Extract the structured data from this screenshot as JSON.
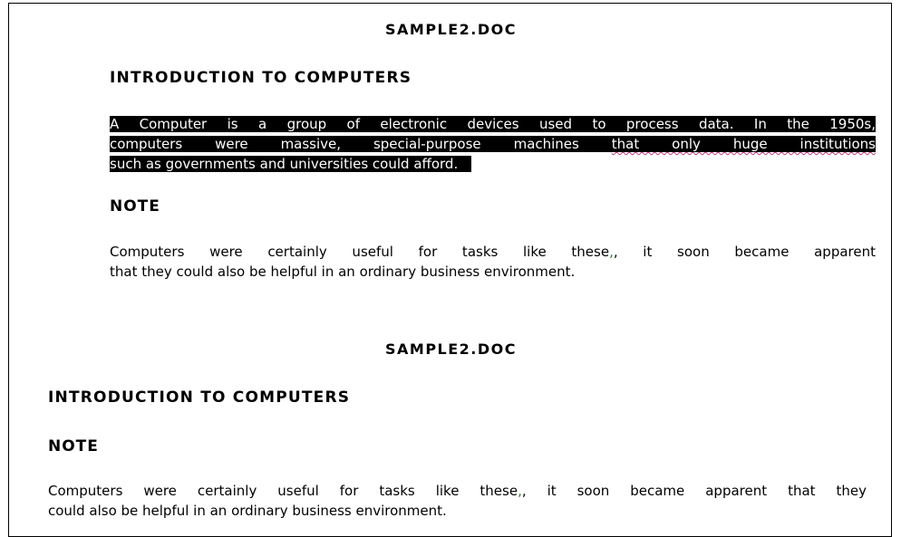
{
  "section1": {
    "doc_title": "SAMPLE2.DOC",
    "heading": "INTRODUCTION TO COMPUTERS",
    "selected_paragraph": {
      "line1": "A Computer is a group of electronic devices used to process data. In the 1950s,",
      "line2_a": "computers were massive, special-purpose machines",
      "line2_b": "that only huge institutions",
      "line3": "such as governments and universities could afford."
    },
    "note_heading": "NOTE",
    "note_paragraph": {
      "line1_a": "Computers were certainly useful for tasks like these",
      "line1_b": ", it soon became apparent",
      "line2": "that they could also be helpful in an ordinary business environment."
    }
  },
  "section2": {
    "doc_title": "SAMPLE2.DOC",
    "heading": "INTRODUCTION TO COMPUTERS",
    "note_heading": "NOTE",
    "note_paragraph": {
      "line1_a": "Computers were certainly useful for tasks like these",
      "line1_b": ", it soon became apparent that they",
      "line2": "could also be helpful in an ordinary business environment."
    }
  },
  "colors": {
    "selection_background": "#000000",
    "selection_text": "#ffffff",
    "spelling_underline": "#c0397a",
    "grammar_mark": "#2e7d32"
  }
}
